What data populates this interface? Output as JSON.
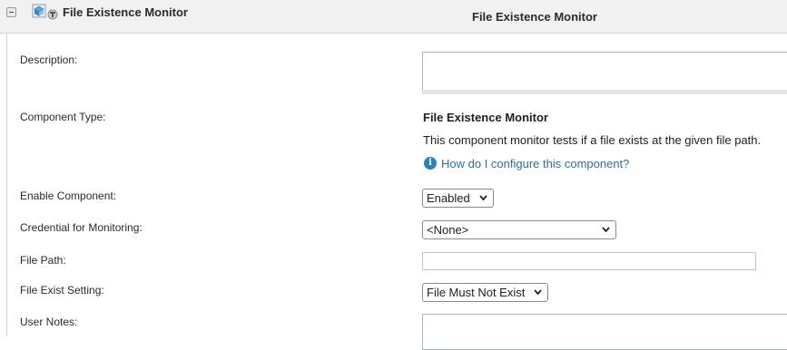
{
  "header": {
    "title": "File Existence Monitor",
    "center_title": "File Existence Monitor"
  },
  "form": {
    "description_label": "Description:",
    "description_value": "",
    "component_type_label": "Component Type:",
    "component_type_name": "File Existence Monitor",
    "component_type_desc": "This component monitor tests if a file exists at the given file path.",
    "help_link": "How do I configure this component?",
    "enable_label": "Enable Component:",
    "enable_value": "Enabled",
    "credential_label": "Credential for Monitoring:",
    "credential_value": "<None>",
    "filepath_label": "File Path:",
    "filepath_value": "",
    "exist_setting_label": "File Exist Setting:",
    "exist_setting_value": "File Must Not Exist",
    "notes_label": "User Notes:",
    "notes_value": ""
  },
  "icons": {
    "collapse": "collapse-minus-icon",
    "component": "component-monitor-icon",
    "info": "info-icon",
    "chevron": "chevron-down-icon"
  }
}
